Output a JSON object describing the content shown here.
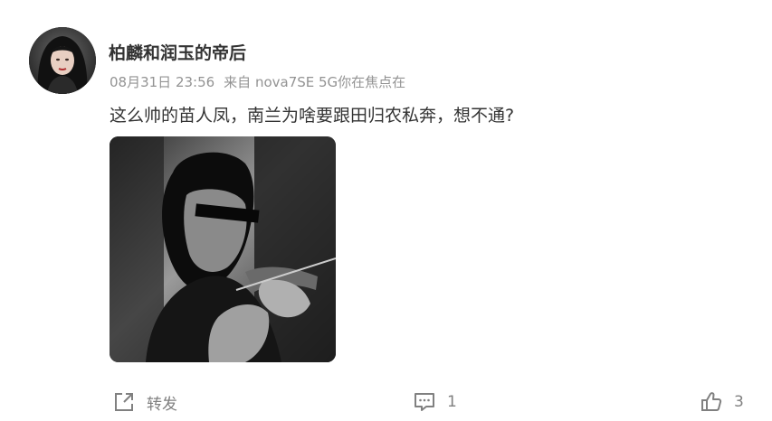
{
  "post": {
    "username": "柏麟和润玉的帝后",
    "date": "08月31日 23:56",
    "source": "来自 nova7SE 5G你在焦点在",
    "text": "这么帅的苗人凤，南兰为啥要跟田归农私奔，想不通?",
    "actions": {
      "repost_label": "转发",
      "comment_count": "1",
      "like_count": "3"
    }
  },
  "icons": {
    "repost": "share-arrow-icon",
    "comment": "comment-bubble-icon",
    "like": "thumbs-up-icon"
  },
  "colors": {
    "username": "#333333",
    "meta": "#939393",
    "text": "#333333",
    "action": "#808080"
  }
}
